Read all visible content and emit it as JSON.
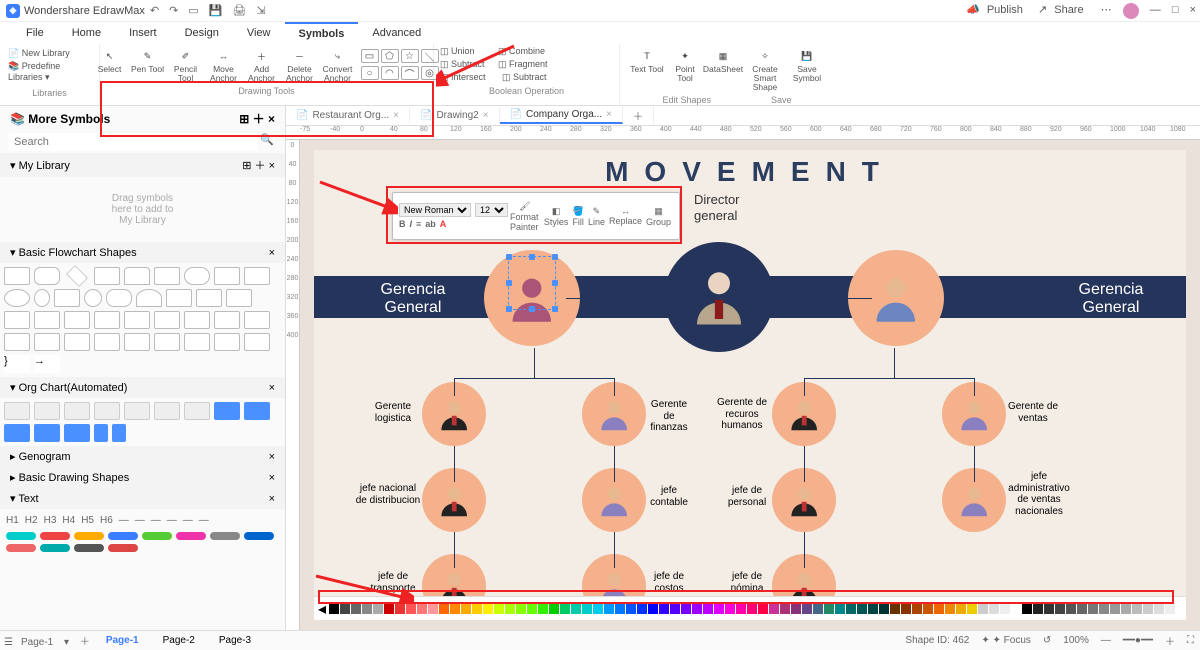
{
  "app": {
    "title": "Wondershare EdrawMax"
  },
  "titlebar_right": {
    "publish": "Publish",
    "share": "Share"
  },
  "menus": [
    "File",
    "Home",
    "Insert",
    "Design",
    "View",
    "Symbols",
    "Advanced"
  ],
  "active_menu": "Symbols",
  "ribbon": {
    "libraries": {
      "new": "New Library",
      "predef": "Predefine Libraries",
      "group": "Libraries"
    },
    "drawing": {
      "tools": [
        "Select",
        "Pen Tool",
        "Pencil Tool",
        "Move Anchor",
        "Add Anchor",
        "Delete Anchor",
        "Convert Anchor"
      ],
      "group": "Drawing Tools"
    },
    "boolean": {
      "ops": [
        "Union",
        "Combine",
        "Subtract",
        "Fragment",
        "Intersect",
        "Subtract"
      ],
      "group": "Boolean Operation"
    },
    "edit": {
      "tools": [
        "Text Tool",
        "Point Tool",
        "DataSheet",
        "Create Smart Shape",
        "Save Symbol"
      ],
      "g1": "Edit Shapes",
      "g2": "Save"
    }
  },
  "left": {
    "more": "More Symbols",
    "search_ph": "Search",
    "mylib": "My Library",
    "hint_l1": "Drag symbols",
    "hint_l2": "here to add to",
    "hint_l3": "My Library",
    "sections": {
      "flow": "Basic Flowchart Shapes",
      "org": "Org Chart(Automated)",
      "geno": "Genogram",
      "basic": "Basic Drawing Shapes",
      "text": "Text"
    },
    "text_headings": [
      "H1",
      "H2",
      "H3",
      "H4",
      "H5",
      "H6"
    ]
  },
  "tabs": [
    "Restaurant Org...",
    "Drawing2",
    "Company Orga..."
  ],
  "active_tab": "Company Orga...",
  "ruler_vals": [
    "-75",
    "-40",
    "0",
    "40",
    "80",
    "120",
    "160",
    "200",
    "240",
    "280",
    "320",
    "360",
    "400",
    "440",
    "480",
    "520",
    "560",
    "600",
    "640",
    "680",
    "720",
    "760",
    "800",
    "840",
    "880",
    "920",
    "960",
    "1000",
    "1040",
    "1080"
  ],
  "vruler_vals": [
    "0",
    "40",
    "80",
    "120",
    "160",
    "200",
    "240",
    "280",
    "320",
    "360",
    "400"
  ],
  "org": {
    "title": "MOVEMENT",
    "dir1": "Director",
    "dir2": "general",
    "left_side": "Gerencia General",
    "right_side": "Gerencia General",
    "row2": [
      "Gerente logistica",
      "Gerente de finanzas",
      "Gerente de recuros humanos",
      "Gerente de ventas"
    ],
    "row3": [
      "jefe nacional de distribucion",
      "jefe contable",
      "jefe de personal",
      "jefe administrativo de ventas nacionales"
    ],
    "row4": [
      "jefe de transporte",
      "jefe de costos",
      "jefe de nómina"
    ]
  },
  "float": {
    "font": "New Roman",
    "size": "12",
    "labels": [
      "Format Painter",
      "Styles",
      "Fill",
      "Line",
      "Replace",
      "Group"
    ]
  },
  "pagetabs": [
    "Page-1",
    "Page-2",
    "Page-3"
  ],
  "status": {
    "shapeid": "Shape ID: 462",
    "focus": "Focus",
    "zoom": "100%"
  },
  "swatches": [
    "#000",
    "#444",
    "#666",
    "#888",
    "#aaa",
    "#c00",
    "#e33",
    "#f55",
    "#f77",
    "#f99",
    "#f60",
    "#f80",
    "#fa0",
    "#fc0",
    "#fe0",
    "#cf0",
    "#af0",
    "#8f0",
    "#6f0",
    "#3e0",
    "#0c0",
    "#0c6",
    "#0ca",
    "#0cc",
    "#0ce",
    "#09f",
    "#07f",
    "#05f",
    "#03f",
    "#00f",
    "#30f",
    "#50f",
    "#70f",
    "#90f",
    "#b0f",
    "#d0f",
    "#f0d",
    "#f0a",
    "#f07",
    "#f04",
    "#c39",
    "#a37",
    "#837",
    "#648",
    "#468",
    "#286",
    "#088",
    "#066",
    "#055",
    "#044",
    "#033",
    "#630",
    "#830",
    "#a40",
    "#c50",
    "#e60",
    "#e80",
    "#ea0",
    "#ec0",
    "#ccc",
    "#ddd",
    "#eee",
    "#fff",
    "#000",
    "#222",
    "#333",
    "#444",
    "#555",
    "#666",
    "#777",
    "#888",
    "#999",
    "#aaa",
    "#bbb",
    "#ccc",
    "#ddd",
    "#eee"
  ]
}
